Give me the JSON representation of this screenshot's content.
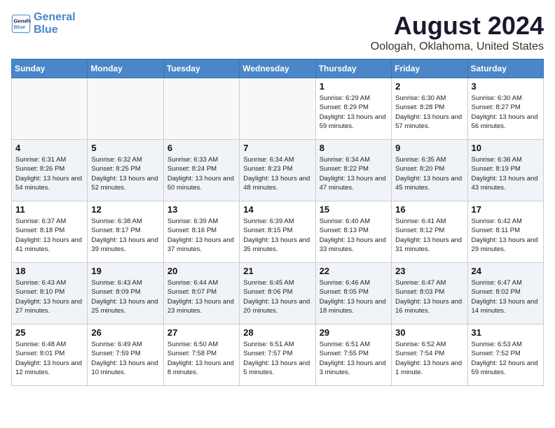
{
  "header": {
    "logo_line1": "General",
    "logo_line2": "Blue",
    "month": "August 2024",
    "location": "Oologah, Oklahoma, United States"
  },
  "days_of_week": [
    "Sunday",
    "Monday",
    "Tuesday",
    "Wednesday",
    "Thursday",
    "Friday",
    "Saturday"
  ],
  "weeks": [
    [
      {
        "day": null
      },
      {
        "day": null
      },
      {
        "day": null
      },
      {
        "day": null
      },
      {
        "day": "1",
        "sunrise": "6:29 AM",
        "sunset": "8:29 PM",
        "daylight": "13 hours and 59 minutes."
      },
      {
        "day": "2",
        "sunrise": "6:30 AM",
        "sunset": "8:28 PM",
        "daylight": "13 hours and 57 minutes."
      },
      {
        "day": "3",
        "sunrise": "6:30 AM",
        "sunset": "8:27 PM",
        "daylight": "13 hours and 56 minutes."
      }
    ],
    [
      {
        "day": "4",
        "sunrise": "6:31 AM",
        "sunset": "8:26 PM",
        "daylight": "13 hours and 54 minutes."
      },
      {
        "day": "5",
        "sunrise": "6:32 AM",
        "sunset": "8:25 PM",
        "daylight": "13 hours and 52 minutes."
      },
      {
        "day": "6",
        "sunrise": "6:33 AM",
        "sunset": "8:24 PM",
        "daylight": "13 hours and 50 minutes."
      },
      {
        "day": "7",
        "sunrise": "6:34 AM",
        "sunset": "8:23 PM",
        "daylight": "13 hours and 48 minutes."
      },
      {
        "day": "8",
        "sunrise": "6:34 AM",
        "sunset": "8:22 PM",
        "daylight": "13 hours and 47 minutes."
      },
      {
        "day": "9",
        "sunrise": "6:35 AM",
        "sunset": "8:20 PM",
        "daylight": "13 hours and 45 minutes."
      },
      {
        "day": "10",
        "sunrise": "6:36 AM",
        "sunset": "8:19 PM",
        "daylight": "13 hours and 43 minutes."
      }
    ],
    [
      {
        "day": "11",
        "sunrise": "6:37 AM",
        "sunset": "8:18 PM",
        "daylight": "13 hours and 41 minutes."
      },
      {
        "day": "12",
        "sunrise": "6:38 AM",
        "sunset": "8:17 PM",
        "daylight": "13 hours and 39 minutes."
      },
      {
        "day": "13",
        "sunrise": "6:39 AM",
        "sunset": "8:16 PM",
        "daylight": "13 hours and 37 minutes."
      },
      {
        "day": "14",
        "sunrise": "6:39 AM",
        "sunset": "8:15 PM",
        "daylight": "13 hours and 35 minutes."
      },
      {
        "day": "15",
        "sunrise": "6:40 AM",
        "sunset": "8:13 PM",
        "daylight": "13 hours and 33 minutes."
      },
      {
        "day": "16",
        "sunrise": "6:41 AM",
        "sunset": "8:12 PM",
        "daylight": "13 hours and 31 minutes."
      },
      {
        "day": "17",
        "sunrise": "6:42 AM",
        "sunset": "8:11 PM",
        "daylight": "13 hours and 29 minutes."
      }
    ],
    [
      {
        "day": "18",
        "sunrise": "6:43 AM",
        "sunset": "8:10 PM",
        "daylight": "13 hours and 27 minutes."
      },
      {
        "day": "19",
        "sunrise": "6:43 AM",
        "sunset": "8:09 PM",
        "daylight": "13 hours and 25 minutes."
      },
      {
        "day": "20",
        "sunrise": "6:44 AM",
        "sunset": "8:07 PM",
        "daylight": "13 hours and 23 minutes."
      },
      {
        "day": "21",
        "sunrise": "6:45 AM",
        "sunset": "8:06 PM",
        "daylight": "13 hours and 20 minutes."
      },
      {
        "day": "22",
        "sunrise": "6:46 AM",
        "sunset": "8:05 PM",
        "daylight": "13 hours and 18 minutes."
      },
      {
        "day": "23",
        "sunrise": "6:47 AM",
        "sunset": "8:03 PM",
        "daylight": "13 hours and 16 minutes."
      },
      {
        "day": "24",
        "sunrise": "6:47 AM",
        "sunset": "8:02 PM",
        "daylight": "13 hours and 14 minutes."
      }
    ],
    [
      {
        "day": "25",
        "sunrise": "6:48 AM",
        "sunset": "8:01 PM",
        "daylight": "13 hours and 12 minutes."
      },
      {
        "day": "26",
        "sunrise": "6:49 AM",
        "sunset": "7:59 PM",
        "daylight": "13 hours and 10 minutes."
      },
      {
        "day": "27",
        "sunrise": "6:50 AM",
        "sunset": "7:58 PM",
        "daylight": "13 hours and 8 minutes."
      },
      {
        "day": "28",
        "sunrise": "6:51 AM",
        "sunset": "7:57 PM",
        "daylight": "13 hours and 5 minutes."
      },
      {
        "day": "29",
        "sunrise": "6:51 AM",
        "sunset": "7:55 PM",
        "daylight": "13 hours and 3 minutes."
      },
      {
        "day": "30",
        "sunrise": "6:52 AM",
        "sunset": "7:54 PM",
        "daylight": "13 hours and 1 minute."
      },
      {
        "day": "31",
        "sunrise": "6:53 AM",
        "sunset": "7:52 PM",
        "daylight": "12 hours and 59 minutes."
      }
    ]
  ]
}
